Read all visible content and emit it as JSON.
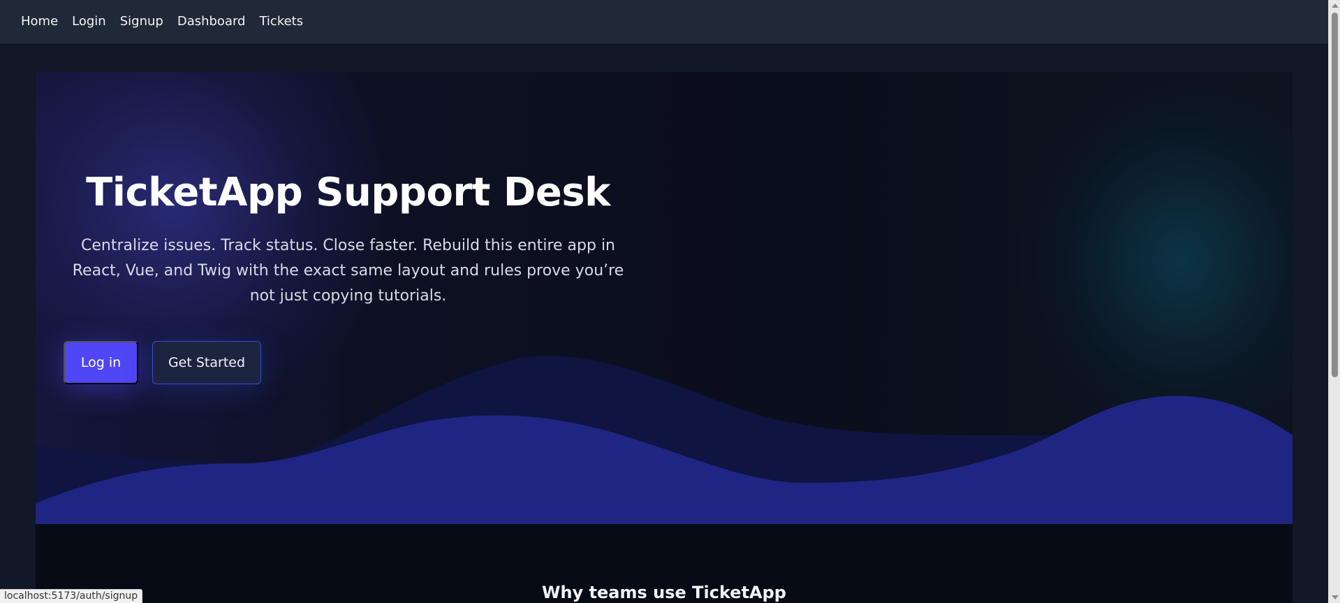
{
  "nav": {
    "items": [
      {
        "label": "Home"
      },
      {
        "label": "Login"
      },
      {
        "label": "Signup"
      },
      {
        "label": "Dashboard"
      },
      {
        "label": "Tickets"
      }
    ]
  },
  "hero": {
    "title": "TicketApp Support Desk",
    "subtitle": "Centralize issues. Track status. Close faster. Rebuild this entire app in React, Vue, and Twig with the exact same layout and rules prove you’re not just copying tutorials.",
    "primary_button": "Log in",
    "secondary_button": "Get Started"
  },
  "features": {
    "title": "Why teams use TicketApp"
  },
  "statusbar": {
    "url": "localhost:5173/auth/signup"
  },
  "colors": {
    "accent": "#4f46f5",
    "nav_bg": "#1f2937",
    "page_bg": "#111827",
    "wave_front": "#1f2583",
    "wave_back": "#0f1440"
  }
}
